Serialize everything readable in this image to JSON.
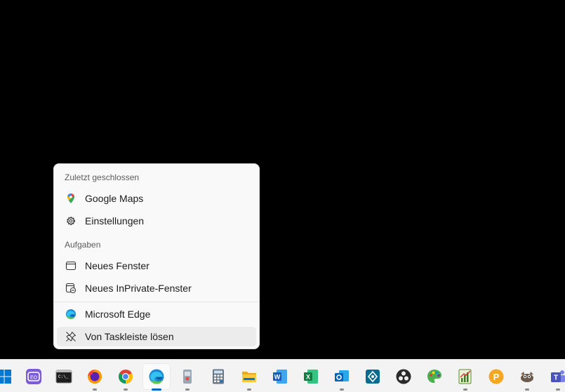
{
  "jumplist": {
    "recent_header": "Zuletzt geschlossen",
    "recent_items": [
      {
        "label": "Google Maps",
        "icon": "google-maps-icon"
      },
      {
        "label": "Einstellungen",
        "icon": "gear-icon"
      }
    ],
    "tasks_header": "Aufgaben",
    "tasks": [
      {
        "label": "Neues Fenster",
        "icon": "window-icon"
      },
      {
        "label": "Neues InPrivate-Fenster",
        "icon": "inprivate-window-icon"
      }
    ],
    "app_label": "Microsoft Edge",
    "unpin_label": "Von Taskleiste lösen"
  },
  "taskbar": {
    "icons": [
      "start-icon",
      "terminal-alt-icon",
      "cmd-icon",
      "firefox-icon",
      "chrome-icon",
      "edge-icon",
      "registry-icon",
      "calculator-icon",
      "file-explorer-icon",
      "word-icon",
      "excel-icon",
      "outlook-icon",
      "vpn-icon",
      "obs-icon",
      "paint-icon",
      "chart-app-icon",
      "p-app-icon",
      "gimp-icon",
      "teams-icon"
    ],
    "active": "edge-icon"
  },
  "colors": {
    "accent": "#0067c0",
    "menu_bg": "#f9f9f9",
    "taskbar_bg": "#f3f3f3"
  }
}
